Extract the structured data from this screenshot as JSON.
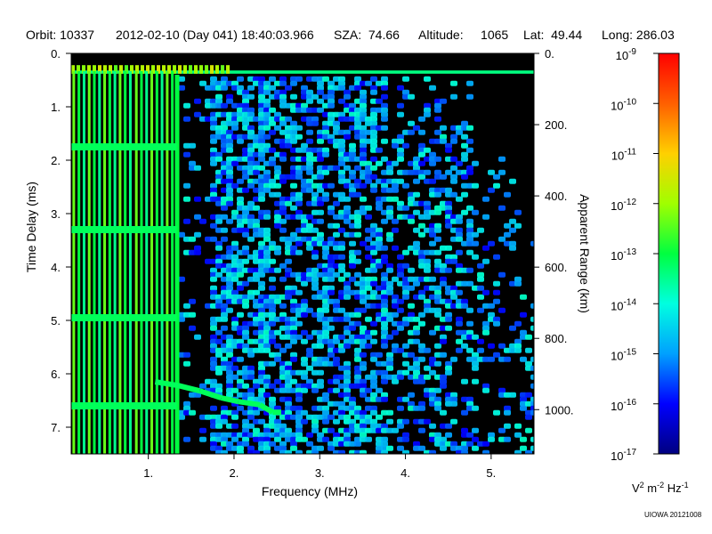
{
  "header": {
    "orbit": "Orbit: 10337",
    "datetime": "2012-02-10 (Day 041) 18:40:03.966",
    "sza": "SZA:  74.66",
    "altitude": "Altitude:     1065",
    "lat": "Lat:  49.44",
    "long": "Long: 286.03"
  },
  "credit": "UIOWA 20121008",
  "chart_data": {
    "type": "heatmap",
    "title": "",
    "xlabel": "Frequency (MHz)",
    "ylabel": "Time Delay (ms)",
    "y2label": "Apparent Range (km)",
    "xlim": [
      0.1,
      5.5
    ],
    "ylim": [
      0,
      7.5
    ],
    "y_inverted": true,
    "x_ticks": [
      {
        "value": 1,
        "label": "1."
      },
      {
        "value": 2,
        "label": "2."
      },
      {
        "value": 3,
        "label": "3."
      },
      {
        "value": 4,
        "label": "4."
      },
      {
        "value": 5,
        "label": "5."
      }
    ],
    "y_ticks": [
      {
        "value": 0,
        "label": "0."
      },
      {
        "value": 1,
        "label": "1."
      },
      {
        "value": 2,
        "label": "2."
      },
      {
        "value": 3,
        "label": "3."
      },
      {
        "value": 4,
        "label": "4."
      },
      {
        "value": 5,
        "label": "5."
      },
      {
        "value": 6,
        "label": "6."
      },
      {
        "value": 7,
        "label": "7."
      }
    ],
    "y2_ticks": [
      {
        "value": 0,
        "label": "0."
      },
      {
        "value": 200,
        "label": "200."
      },
      {
        "value": 400,
        "label": "400."
      },
      {
        "value": 600,
        "label": "600."
      },
      {
        "value": 800,
        "label": "800."
      },
      {
        "value": 1000,
        "label": "1000."
      }
    ],
    "y2_km_per_ms": 149.9,
    "colorbar": {
      "scale": "log",
      "min_exp": -17,
      "max_exp": -9,
      "tick_exps": [
        -9,
        -10,
        -11,
        -12,
        -13,
        -14,
        -15,
        -16,
        -17
      ],
      "tick_labels": [
        "10",
        "10",
        "10",
        "10",
        "10",
        "10",
        "10",
        "10",
        "10"
      ],
      "tick_sups": [
        "-9",
        "-10",
        "-11",
        "-12",
        "-13",
        "-14",
        "-15",
        "-16",
        "-17"
      ],
      "units_main": [
        "V",
        " m",
        " Hz"
      ],
      "units_sup": [
        "2",
        "-2",
        "-1"
      ],
      "colors": [
        "#000080",
        "#0000ff",
        "#00a0ff",
        "#00ffe0",
        "#00ff40",
        "#a0ff00",
        "#ffd000",
        "#ff6000",
        "#ff0000"
      ]
    },
    "features": {
      "background": "#000000",
      "ground_echo_delay": [
        0.32,
        0.38
      ],
      "harmonic_freqs": [
        0.13,
        0.19,
        0.25,
        0.31,
        0.37,
        0.43,
        0.49,
        0.55,
        0.61,
        0.67,
        0.73,
        0.79,
        0.86,
        0.92,
        0.98,
        1.04,
        1.1,
        1.16,
        1.22,
        1.28
      ],
      "plasma_freq_echo_delays": [
        1.75,
        3.3,
        4.95,
        6.6
      ],
      "ionosphere_trace": [
        {
          "f": 1.08,
          "t": 6.15
        },
        {
          "f": 1.35,
          "t": 6.22
        },
        {
          "f": 1.6,
          "t": 6.32
        },
        {
          "f": 1.85,
          "t": 6.45
        },
        {
          "f": 2.05,
          "t": 6.52
        },
        {
          "f": 2.3,
          "t": 6.58
        },
        {
          "f": 2.45,
          "t": 6.72
        },
        {
          "f": 2.55,
          "t": 6.72
        }
      ]
    }
  }
}
